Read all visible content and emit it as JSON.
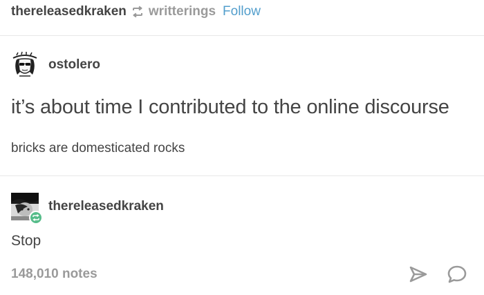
{
  "header": {
    "reblogger": "thereleasedkraken",
    "reblog_icon": "reblog-icon",
    "source": "writterings",
    "follow_label": "Follow"
  },
  "original_post": {
    "blog_name": "ostolero",
    "title": "it’s about time I contributed to the online discourse",
    "body": "bricks are domesticated rocks"
  },
  "reblog": {
    "blog_name": "thereleasedkraken",
    "text": "Stop"
  },
  "footer": {
    "notes": "148,010 notes",
    "share_icon": "send-icon",
    "reply_icon": "reply-bubble-icon"
  },
  "colors": {
    "text": "#444444",
    "muted": "#9a9a9a",
    "link": "#529ecc",
    "reblog_green": "#56bc8a",
    "divider": "#e7e7e7"
  }
}
